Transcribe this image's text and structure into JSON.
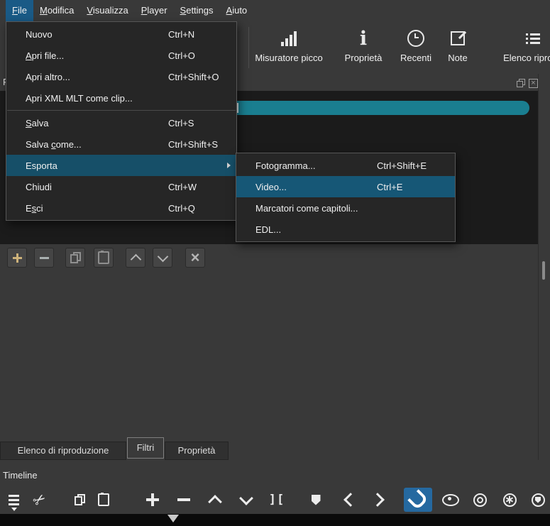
{
  "colors": {
    "window_bg": "#393939",
    "panel_bg": "#1b1b1b",
    "menu_bg": "#262626",
    "menubar_active_bg": "#1a5a86",
    "menu_highlight_bg": "#164f68",
    "submenu_highlight_bg": "#165776",
    "search_bar": "#1a7e90",
    "snap_active_bg": "#2569a0",
    "add_button_icon": "#cdb27a",
    "bottom_strip": "#0a0a0a"
  },
  "menubar": {
    "items": [
      {
        "pre": "",
        "u": "F",
        "post": "ile",
        "active": true
      },
      {
        "pre": "",
        "u": "M",
        "post": "odifica"
      },
      {
        "pre": "",
        "u": "V",
        "post": "isualizza"
      },
      {
        "pre": "",
        "u": "P",
        "post": "layer"
      },
      {
        "pre": "",
        "u": "S",
        "post": "ettings"
      },
      {
        "pre": "",
        "u": "A",
        "post": "iuto"
      }
    ]
  },
  "toolbar": {
    "items": [
      {
        "label": "Misuratore picco",
        "icon": "peak-meter-icon"
      },
      {
        "label": "Proprietà",
        "icon": "info-icon"
      },
      {
        "label": "Recenti",
        "icon": "clock-icon"
      },
      {
        "label": "Note",
        "icon": "note-icon"
      },
      {
        "label": "Elenco riprodu",
        "icon": "playlist-icon"
      }
    ]
  },
  "file_menu": {
    "items": [
      {
        "pre": "Nuovo",
        "shortcut": "Ctrl+N"
      },
      {
        "pre": "",
        "u": "A",
        "post": "pri file...",
        "shortcut": "Ctrl+O"
      },
      {
        "pre": "Apri altro...",
        "shortcut": "Ctrl+Shift+O"
      },
      {
        "pre": "Apri XML MLT come clip...",
        "shortcut": ""
      },
      {
        "pre": "",
        "u": "S",
        "post": "alva",
        "shortcut": "Ctrl+S"
      },
      {
        "pre": "Salva ",
        "u": "c",
        "post": "ome...",
        "shortcut": "Ctrl+Shift+S"
      },
      {
        "pre": "Esporta",
        "shortcut": "",
        "highlighted": true,
        "has_submenu": true
      },
      {
        "pre": "Chiudi",
        "shortcut": "Ctrl+W"
      },
      {
        "pre": "E",
        "u": "s",
        "post": "ci",
        "shortcut": "Ctrl+Q"
      }
    ]
  },
  "export_submenu": {
    "items": [
      {
        "label": "Fotogramma...",
        "shortcut": "Ctrl+Shift+E"
      },
      {
        "label": "Video...",
        "shortcut": "Ctrl+E",
        "highlighted": true
      },
      {
        "label": "Marcatori come capitoli...",
        "shortcut": ""
      },
      {
        "label": "EDL...",
        "shortcut": ""
      }
    ]
  },
  "filters_panel": {
    "title": "Filtri",
    "search_value": "",
    "window_icons": [
      "float-panel-icon",
      "close-panel-icon"
    ],
    "action_buttons": [
      "add-filter",
      "remove-filter",
      "copy-filters",
      "paste-filters",
      "move-filter-up",
      "move-filter-down",
      "deselect-filter"
    ]
  },
  "tabs": {
    "items": [
      {
        "label": "Elenco di riproduzione"
      },
      {
        "label": "Filtri",
        "active": true
      },
      {
        "label": "Proprietà"
      }
    ]
  },
  "timeline": {
    "title": "Timeline",
    "snap_active": true,
    "buttons": [
      "timeline-menu",
      "cut",
      "copy",
      "paste",
      "append",
      "ripple-delete",
      "lift",
      "overwrite",
      "split",
      "marker",
      "previous-marker",
      "next-marker",
      "snap",
      "scrub-while-dragging",
      "ripple",
      "ripple-all-tracks",
      "ripple-markers"
    ]
  }
}
